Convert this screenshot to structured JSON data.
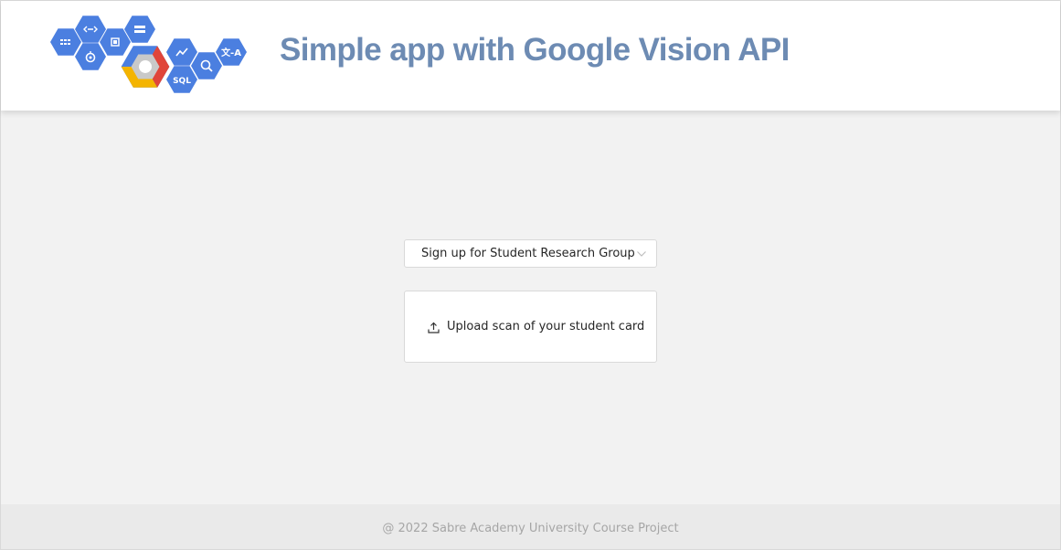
{
  "header": {
    "title": "Simple app with Google Vision API",
    "logo": {
      "name": "google-cloud-platform-logo",
      "badges": [
        "grid-icon",
        "code-icon",
        "chip-icon",
        "server-icon",
        "chart-icon",
        "translate-icon",
        "storage-icon",
        "analytics-icon",
        "sql-icon",
        "cloud-core-icon"
      ],
      "sql_text": "SQL",
      "translate_text": "文-A",
      "code_text": "‹···›"
    }
  },
  "main": {
    "select": {
      "value": "Sign up for Student Research Group",
      "icon": "chevron-down-icon"
    },
    "upload": {
      "label": "Upload scan of your student card",
      "icon": "upload-icon"
    }
  },
  "footer": {
    "text": "@ 2022 Sabre Academy University Course Project"
  },
  "colors": {
    "title": "#6d8bb3",
    "hex_blue": "#4b7fe0",
    "google_red": "#e0453a",
    "google_yellow": "#f4b400",
    "background": "#f2f2f2"
  }
}
